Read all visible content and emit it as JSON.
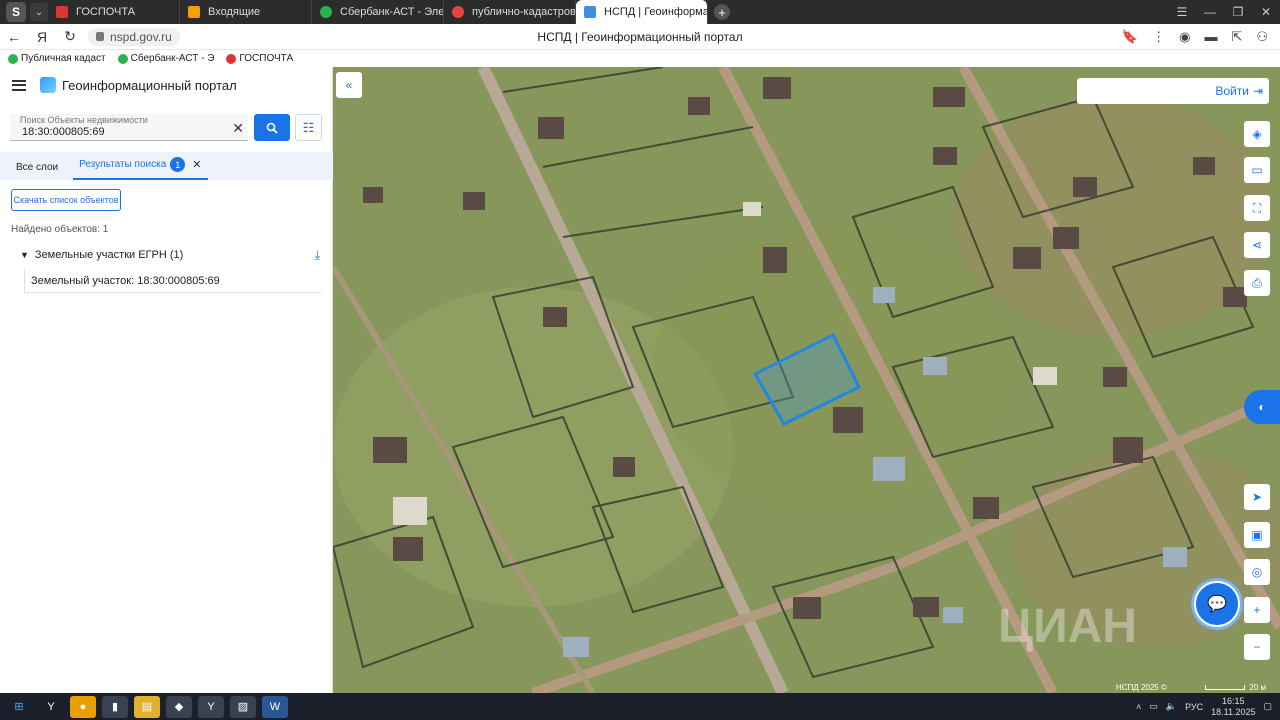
{
  "browser": {
    "tabs": [
      {
        "label": "ГОСПОЧТА",
        "color": "#d33"
      },
      {
        "label": "Входящие",
        "color": "#f5a000"
      },
      {
        "label": "Сбербанк-АСТ - Электро",
        "color": "#2bb24c"
      },
      {
        "label": "публично-кадастровая к",
        "color": "#e8433a"
      },
      {
        "label": "НСПД | Геоинформаци",
        "color": "#3a8fe0",
        "active": true
      }
    ],
    "yandex_letter": "Я",
    "url": "nspd.gov.ru",
    "page_title": "НСПД | Геоинформационный портал",
    "bookmarks": [
      {
        "label": "Публичная кадаст",
        "color": "#2bb24c"
      },
      {
        "label": "Сбербанк-АСТ - Э",
        "color": "#2bb24c"
      },
      {
        "label": "ГОСПОЧТА",
        "color": "#d33"
      }
    ]
  },
  "panel": {
    "title": "Геоинформационный портал",
    "search_placeholder": "Поиск Объекты недвижимости",
    "search_value": "18:30:000805:69",
    "tab_all": "Все слои",
    "tab_results": "Результаты поиска",
    "results_count": "1",
    "download_list": "Скачать список объектов",
    "found": "Найдено объектов: 1",
    "group_title": "Земельные участки ЕГРН (1)",
    "item": "Земельный участок: 18:30:000805:69"
  },
  "map": {
    "login": "Войти",
    "copyright": "НСПД 2025 ©",
    "scale": "20 м",
    "watermark": "ЦИАН"
  },
  "taskbar": {
    "lang": "РУС",
    "time": "16:15",
    "date": "18.11.2025"
  }
}
